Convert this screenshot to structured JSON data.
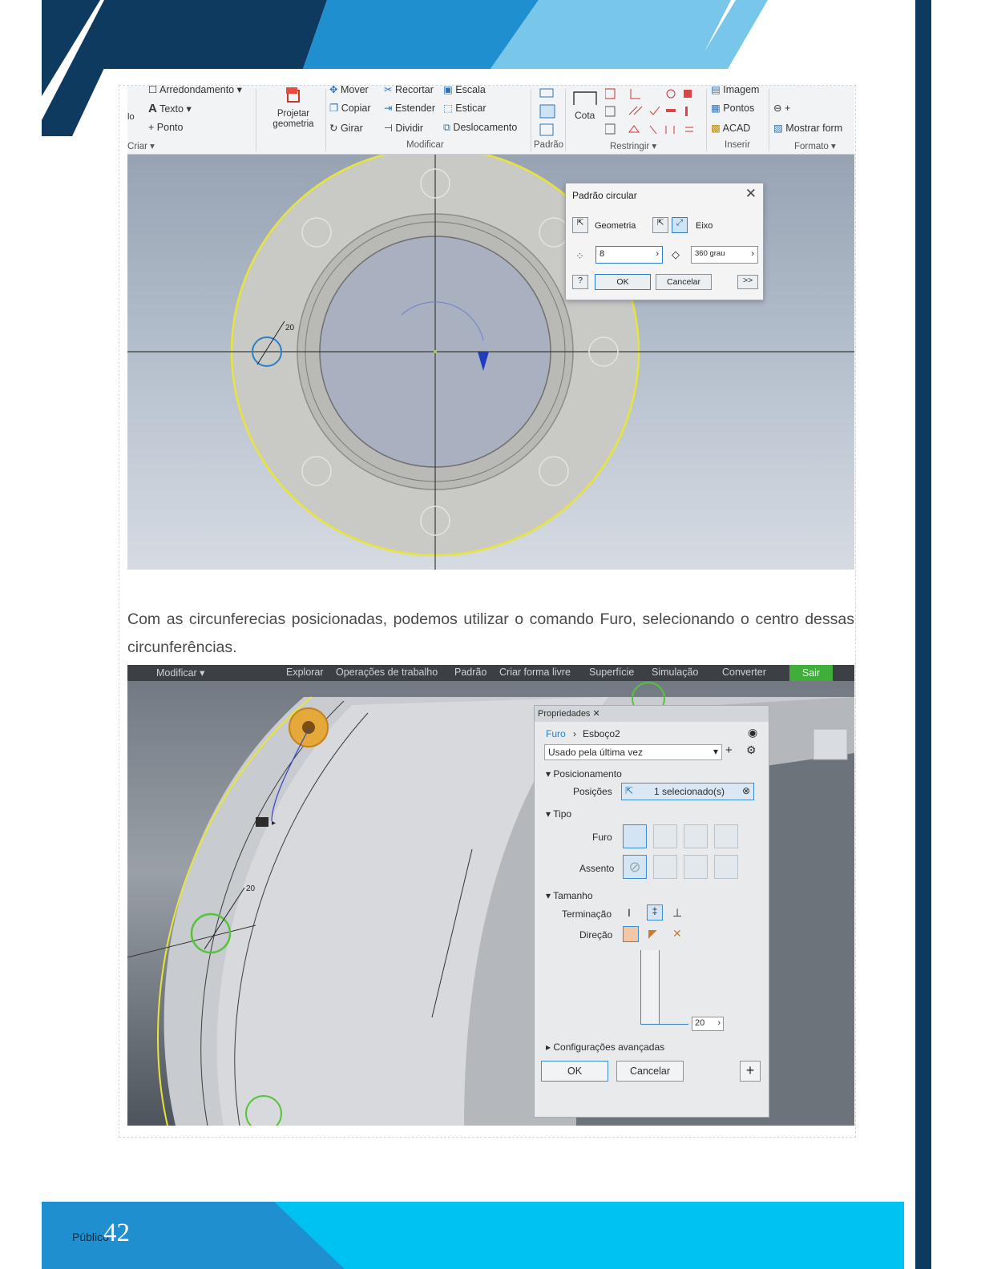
{
  "colors": {
    "navy": "#0d3a5e",
    "mid_blue": "#1f8fd0",
    "light_blue": "#78c6ea",
    "footer_cyan": "#00c2f2",
    "sketch_yellow": "#e8e43a"
  },
  "screenshot1": {
    "ribbon": {
      "criar": {
        "arredondamento": "Arredondamento",
        "texto": "Texto",
        "ponto": "Ponto",
        "label": "Criar ▾",
        "lo": "lo"
      },
      "projetar": "Projetar geometria",
      "modificar": {
        "mover": "Mover",
        "recortar": "Recortar",
        "escala": "Escala",
        "copiar": "Copiar",
        "estender": "Estender",
        "esticar": "Esticar",
        "girar": "Girar",
        "dividir": "Dividir",
        "deslocamento": "Deslocamento",
        "label": "Modificar"
      },
      "padrao_label": "Padrão",
      "cota": "Cota",
      "restringir_label": "Restringir ▾",
      "inserir": {
        "imagem": "Imagem",
        "pontos": "Pontos",
        "acad": "ACAD",
        "label": "Inserir"
      },
      "formato": {
        "mostrar": "Mostrar form",
        "label": "Formato ▾"
      }
    },
    "dimension": "20",
    "dialog": {
      "title": "Padrão circular",
      "close": "✕",
      "geometria": "Geometria",
      "eixo": "Eixo",
      "count_value": "8",
      "angle_value": "360 grau",
      "ok": "OK",
      "cancelar": "Cancelar",
      "more": ">>"
    }
  },
  "paragraph": "Com as circunferecias posicionadas, podemos utilizar o comando Furo, selecionando o centro dessas circunferências.",
  "screenshot2": {
    "menubar": [
      "Modificar ▾",
      "Explorar",
      "Operações de trabalho",
      "Padrão",
      "Criar forma livre",
      "Superfície",
      "Simulação",
      "Converter"
    ],
    "sair": "Sair",
    "dimension": "20",
    "panel": {
      "tab": "Propriedades",
      "tab_close": "✕",
      "breadcrumb_root": "Furo",
      "breadcrumb_sep": "›",
      "breadcrumb_leaf": "Esboço2",
      "preset": "Usado pela última vez",
      "sec_posicionamento": "Posicionamento",
      "posicoes_label": "Posições",
      "posicoes_value": "1 selecionado(s)",
      "sec_tipo": "Tipo",
      "furo_label": "Furo",
      "assento_label": "Assento",
      "sec_tamanho": "Tamanho",
      "terminacao_label": "Terminação",
      "direcao_label": "Direção",
      "depth_value": "20",
      "advanced": "Configurações avançadas",
      "ok": "OK",
      "cancelar": "Cancelar",
      "plus": "+"
    }
  },
  "footer": {
    "label": "Público",
    "page_number": "42"
  }
}
